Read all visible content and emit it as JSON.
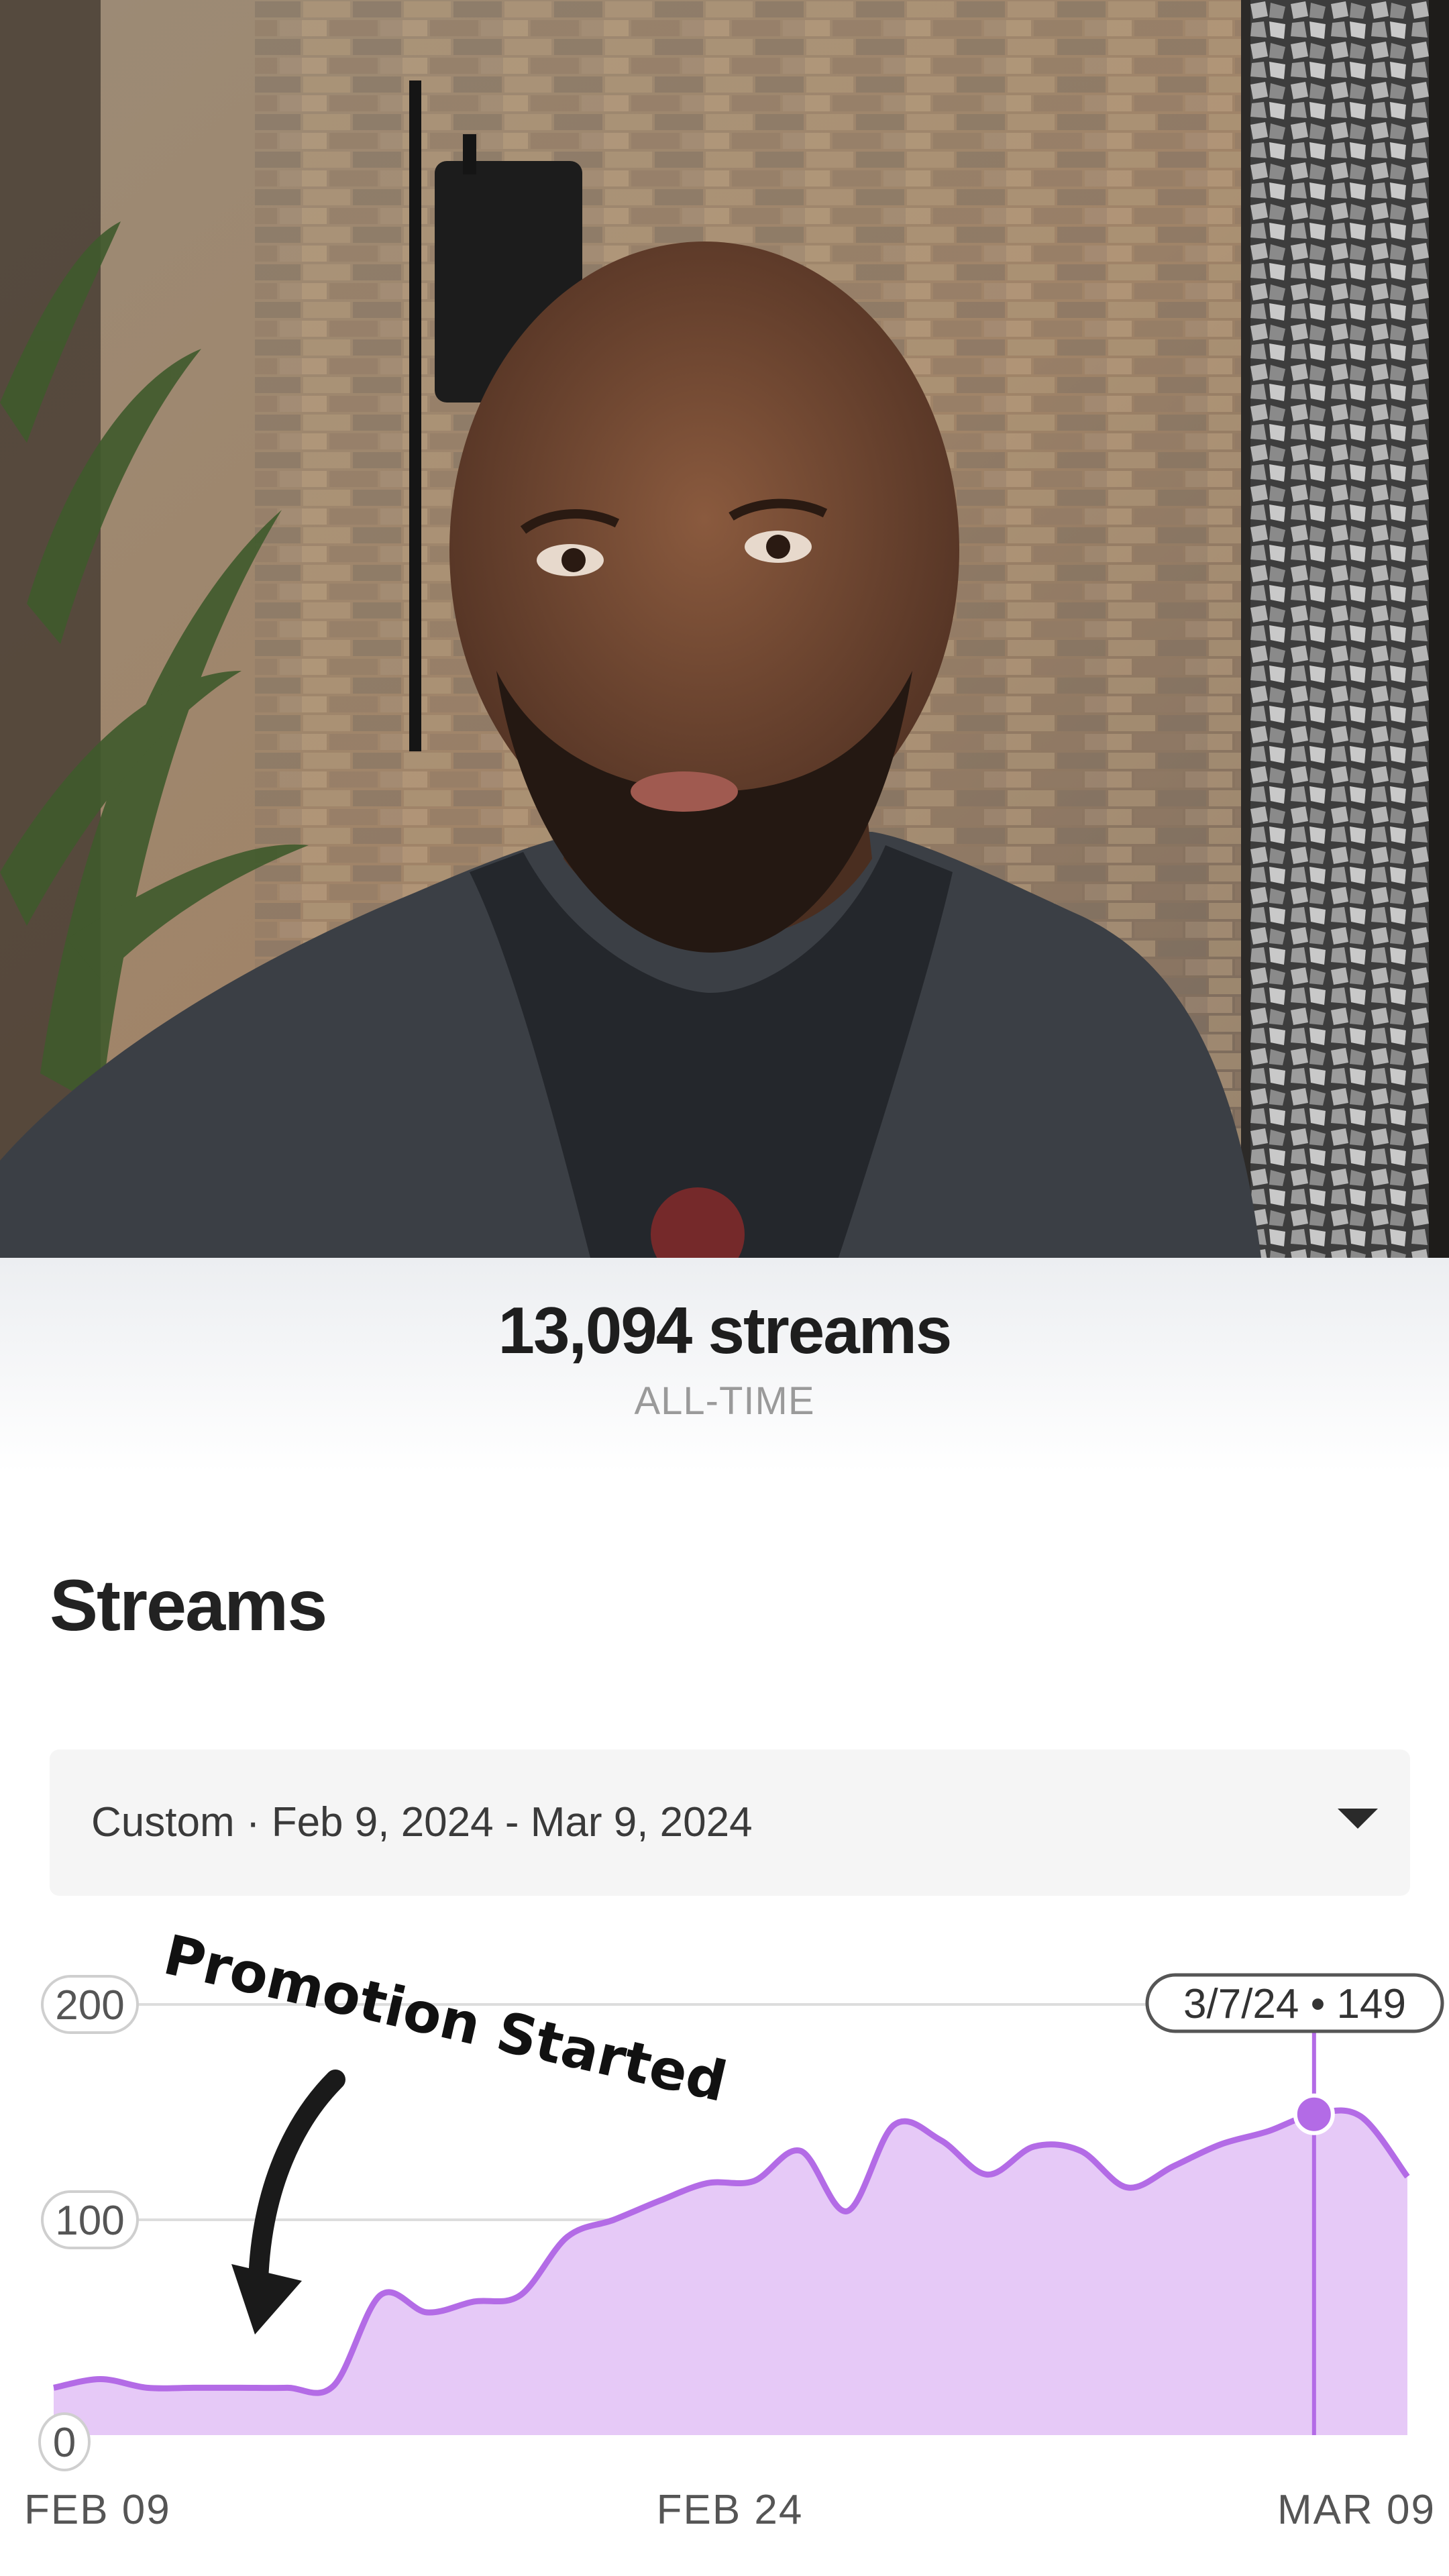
{
  "stats": {
    "total_streams": "13,094 streams",
    "period": "ALL-TIME"
  },
  "section": {
    "title": "Streams"
  },
  "date_range": {
    "label": "Custom · Feb 9, 2024 - Mar 9, 2024"
  },
  "annotation": {
    "text": "Promotion Started",
    "icon": "curved-arrow-down-icon"
  },
  "colors": {
    "accent": "#b36be6",
    "fill": "#e6c9f7",
    "grid": "#dddddd"
  },
  "chart_data": {
    "type": "area",
    "title": "",
    "xlabel": "",
    "ylabel": "",
    "ylim": [
      0,
      200
    ],
    "yticks": [
      "0",
      "100",
      "200"
    ],
    "xtick_labels": [
      "FEB 09",
      "FEB 24",
      "MAR 09"
    ],
    "x": [
      "2024-02-09",
      "2024-02-10",
      "2024-02-11",
      "2024-02-12",
      "2024-02-13",
      "2024-02-14",
      "2024-02-15",
      "2024-02-16",
      "2024-02-17",
      "2024-02-18",
      "2024-02-19",
      "2024-02-20",
      "2024-02-21",
      "2024-02-22",
      "2024-02-23",
      "2024-02-24",
      "2024-02-25",
      "2024-02-26",
      "2024-02-27",
      "2024-02-28",
      "2024-02-29",
      "2024-03-01",
      "2024-03-02",
      "2024-03-03",
      "2024-03-04",
      "2024-03-05",
      "2024-03-06",
      "2024-03-07",
      "2024-03-08",
      "2024-03-09"
    ],
    "values": [
      22,
      26,
      22,
      22,
      22,
      22,
      23,
      65,
      57,
      62,
      65,
      92,
      100,
      109,
      117,
      118,
      132,
      104,
      144,
      137,
      121,
      134,
      132,
      115,
      125,
      135,
      141,
      149,
      148,
      120
    ],
    "grid": true,
    "highlight": {
      "date": "2024-03-07",
      "value": 149,
      "label": "3/7/24 • 149"
    }
  }
}
